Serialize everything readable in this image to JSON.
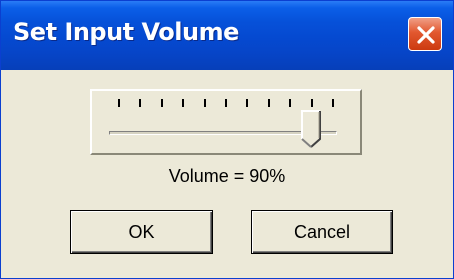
{
  "window": {
    "title": "Set Input Volume",
    "close_icon": "close-icon"
  },
  "slider": {
    "tick_count": 11,
    "value_percent": 90
  },
  "volume_text": "Volume = 90%",
  "buttons": {
    "ok_label": "OK",
    "cancel_label": "Cancel"
  },
  "colors": {
    "titlebar": "#0549d0",
    "close_button": "#e2582f",
    "dialog_background": "#ece9d8"
  }
}
